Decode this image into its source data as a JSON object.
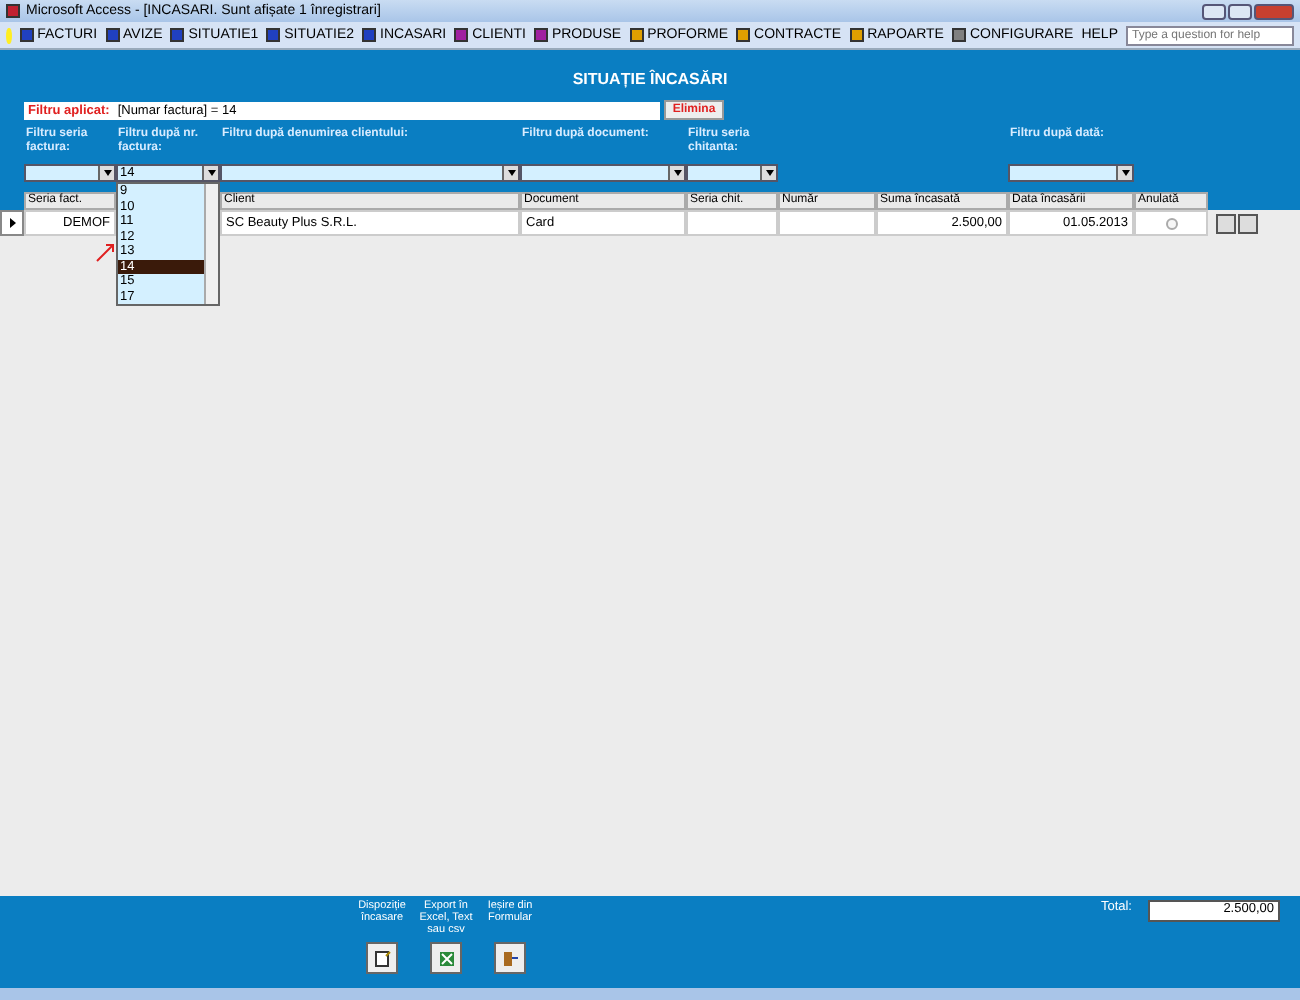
{
  "window": {
    "title": "Microsoft Access - [INCASARI. Sunt afișate 1 înregistrari]"
  },
  "menu": [
    {
      "label": "FACTURI",
      "color": "#2040c0"
    },
    {
      "label": "AVIZE",
      "color": "#2040c0"
    },
    {
      "label": "SITUATIE1",
      "color": "#2040c0"
    },
    {
      "label": "SITUATIE2",
      "color": "#2040c0"
    },
    {
      "label": "INCASARI",
      "color": "#2040c0"
    },
    {
      "label": "CLIENTI",
      "color": "#a020a0"
    },
    {
      "label": "PRODUSE",
      "color": "#a020a0"
    },
    {
      "label": "PROFORME",
      "color": "#e0a000"
    },
    {
      "label": "CONTRACTE",
      "color": "#e0a000"
    },
    {
      "label": "RAPOARTE",
      "color": "#e0a000"
    },
    {
      "label": "CONFIGURARE",
      "color": "#808080"
    },
    {
      "label": "HELP"
    }
  ],
  "help_search": {
    "placeholder": "Type a question for help"
  },
  "form": {
    "title": "SITUAȚIE ÎNCASĂRI",
    "filter_applied": {
      "label": "Filtru aplicat:",
      "value": "[Numar factura] = 14",
      "remove_button": "Elimina"
    },
    "filters": [
      {
        "label": "Filtru seria factura:"
      },
      {
        "label": "Filtru după nr. factura:",
        "value": "14"
      },
      {
        "label": "Filtru după denumirea clientului:"
      },
      {
        "label": "Filtru după document:"
      },
      {
        "label": "Filtru seria chitanta:"
      },
      {
        "label": "Filtru după dată:"
      }
    ],
    "dropdown": {
      "items": [
        {
          "label": "9",
          "selected": false
        },
        {
          "label": "10",
          "selected": false
        },
        {
          "label": "11",
          "selected": false
        },
        {
          "label": "12",
          "selected": false
        },
        {
          "label": "13",
          "selected": false
        },
        {
          "label": "14",
          "selected": true
        },
        {
          "label": "15",
          "selected": false
        },
        {
          "label": "17",
          "selected": false
        }
      ]
    },
    "table": {
      "columns": [
        "Seria fact.",
        "",
        "Client",
        "Document",
        "Seria chit.",
        "Număr",
        "Suma încasată",
        "Data încasării",
        "Anulată"
      ],
      "rows": [
        {
          "cells": [
            "DEMOF",
            "",
            "SC Beauty Plus S.R.L.",
            "Card",
            "",
            "",
            "2.500,00",
            "01.05.2013"
          ],
          "cancelled": false
        }
      ]
    },
    "footer": {
      "buttons": [
        {
          "label": "Dispoziție încasare",
          "kind": "note"
        },
        {
          "label": "Export în Excel, Text sau csv",
          "kind": "excel"
        },
        {
          "label": "Ieșire din Formular",
          "kind": "exit"
        }
      ],
      "total_label": "Total:",
      "total_value": "2.500,00"
    }
  }
}
